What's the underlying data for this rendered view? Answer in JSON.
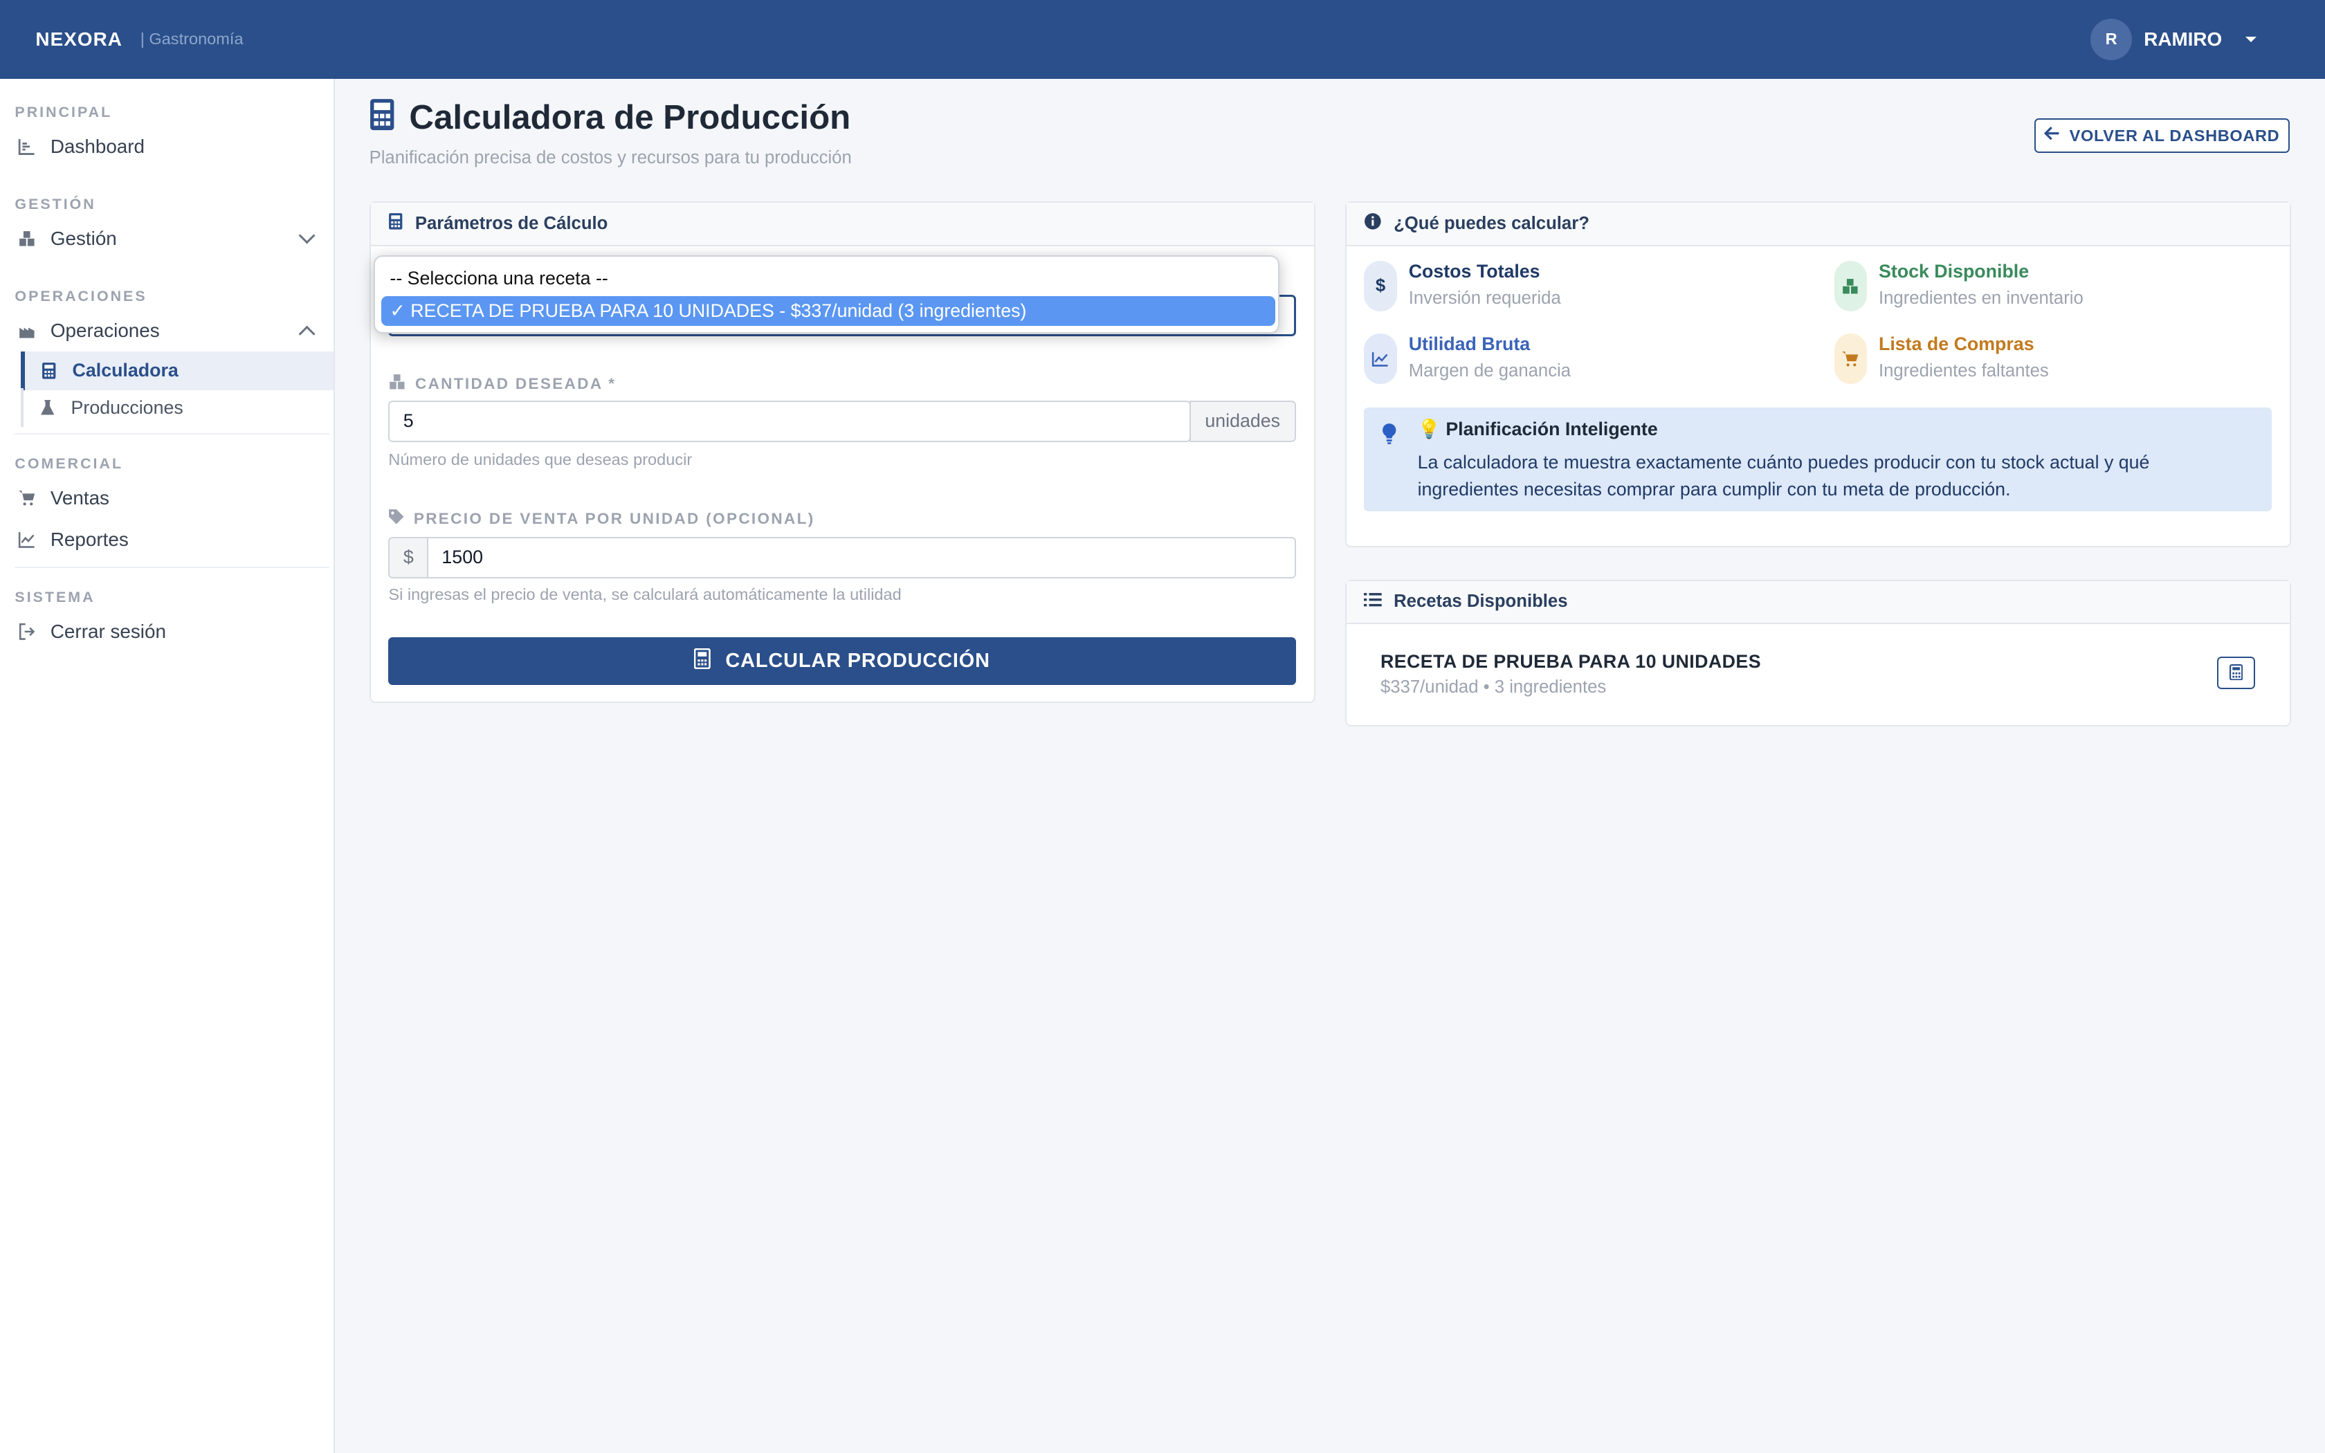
{
  "topbar": {
    "brand": "NEXORA",
    "brand_sub": "| Gastronomía",
    "avatar_initial": "R",
    "user_name": "RAMIRO"
  },
  "sidebar": {
    "sections": {
      "principal": "PRINCIPAL",
      "gestion": "GESTIÓN",
      "operaciones": "OPERACIONES",
      "comercial": "COMERCIAL",
      "sistema": "SISTEMA"
    },
    "items": {
      "dashboard": "Dashboard",
      "gestion": "Gestión",
      "operaciones": "Operaciones",
      "calculadora": "Calculadora",
      "producciones": "Producciones",
      "ventas": "Ventas",
      "reportes": "Reportes",
      "cerrar_sesion": "Cerrar sesión"
    }
  },
  "header": {
    "title": "Calculadora de Producción",
    "subtitle": "Planificación precisa de costos y recursos para tu producción",
    "back_button": "VOLVER AL DASHBOARD"
  },
  "params_card": {
    "title": "Parámetros de Cálculo",
    "recipe_dropdown": {
      "options": [
        "-- Selecciona una receta --",
        "✓ RECETA DE PRUEBA PARA 10 UNIDADES - $337/unidad (3 ingredientes)"
      ]
    },
    "quantity": {
      "label": "CANTIDAD DESEADA *",
      "value": "5",
      "unit": "unidades",
      "help": "Número de unidades que deseas producir"
    },
    "price": {
      "label": "PRECIO DE VENTA POR UNIDAD (OPCIONAL)",
      "currency": "$",
      "value": "1500",
      "help": "Si ingresas el precio de venta, se calculará automáticamente la utilidad"
    },
    "calc_button": "CALCULAR PRODUCCIÓN"
  },
  "info_card": {
    "title": "¿Qué puedes calcular?",
    "features": [
      {
        "title": "Costos Totales",
        "desc": "Inversión requerida",
        "color": "#1f3a66"
      },
      {
        "title": "Stock Disponible",
        "desc": "Ingredientes en inventario",
        "color": "#3a8a5c"
      },
      {
        "title": "Utilidad Bruta",
        "desc": "Margen de ganancia",
        "color": "#3a63b8"
      },
      {
        "title": "Lista de Compras",
        "desc": "Ingredientes faltantes",
        "color": "#c27a1e"
      }
    ],
    "tip_title": "💡 Planificación Inteligente",
    "tip_text": "La calculadora te muestra exactamente cuánto puedes producir con tu stock actual y qué ingredientes necesitas comprar para cumplir con tu meta de producción."
  },
  "recipes_card": {
    "title": "Recetas Disponibles",
    "recipes": [
      {
        "name": "RECETA DE PRUEBA PARA 10 UNIDADES",
        "meta": "$337/unidad • 3 ingredientes"
      }
    ]
  }
}
